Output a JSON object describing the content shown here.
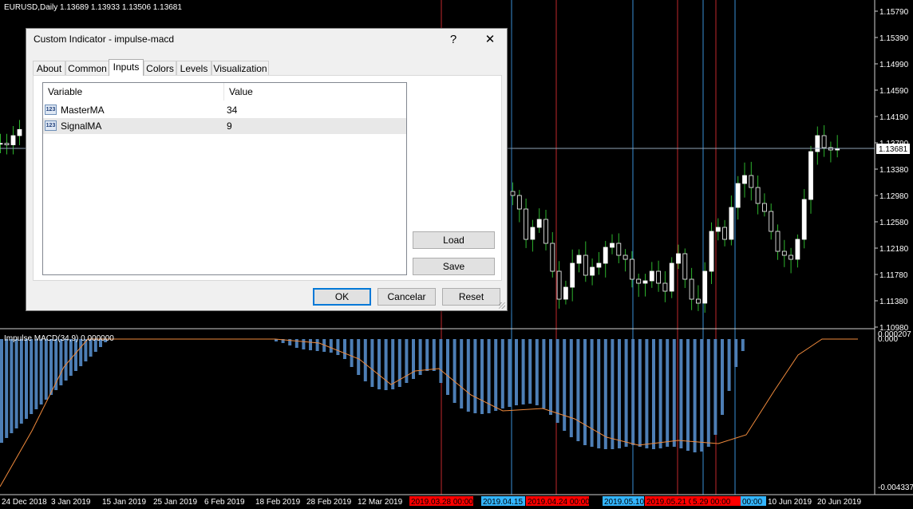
{
  "chart": {
    "header": "EURUSD,Daily  1.13689 1.13933 1.13506 1.13681",
    "price_axis": [
      "1.15790",
      "1.15390",
      "1.14990",
      "1.14590",
      "1.14190",
      "1.13790",
      "1.13380",
      "1.12980",
      "1.12580",
      "1.12180",
      "1.11780",
      "1.11380",
      "1.10980"
    ],
    "current_price": "1.13681",
    "indicator_label": "Impulse MACD(34,9) 0.000000",
    "indicator_axis": [
      "0.000207",
      "0.000",
      "-0.004337"
    ],
    "date_axis": [
      "24 Dec 2018",
      "3 Jan 2019",
      "15 Jan 2019",
      "25 Jan 2019",
      "6 Feb 2019",
      "18 Feb 2019",
      "28 Feb 2019",
      "12 Mar 2019",
      "10 Jun 2019",
      "20 Jun 2019"
    ],
    "date_markers": [
      {
        "label": "2019.03.28 00:00",
        "color": "#ff0000"
      },
      {
        "label": "2019.04.15 0",
        "color": "#33b5ff"
      },
      {
        "label": "2019.04.24 00:00",
        "color": "#ff0000"
      },
      {
        "label": "2019.05.10",
        "color": "#33b5ff"
      },
      {
        "label": "2019.05.21 00:00",
        "color": "#ff0000"
      },
      {
        "label": "5.29 00:00",
        "color": "#ff0000"
      },
      {
        "label": "00:00",
        "color": "#33b5ff"
      }
    ],
    "colors": {
      "bull": "#ffffff",
      "bear": "#ffffff",
      "wick": "#2db32d",
      "histogram": "#4d7eb5",
      "signal": "#f08a3c",
      "red_line": "#c0282d",
      "blue_line": "#3a8fd6"
    }
  },
  "dialog": {
    "title": "Custom Indicator - impulse-macd",
    "help": "?",
    "close": "✕",
    "tabs": [
      "About",
      "Common",
      "Inputs",
      "Colors",
      "Levels",
      "Visualization"
    ],
    "active_tab": "Inputs",
    "grid": {
      "headers": {
        "variable": "Variable",
        "value": "Value"
      },
      "rows": [
        {
          "icon": "123",
          "variable": "MasterMA",
          "value": "34"
        },
        {
          "icon": "123",
          "variable": "SignalMA",
          "value": "9"
        }
      ]
    },
    "buttons": {
      "load": "Load",
      "save": "Save",
      "ok": "OK",
      "cancel": "Cancelar",
      "reset": "Reset"
    }
  }
}
